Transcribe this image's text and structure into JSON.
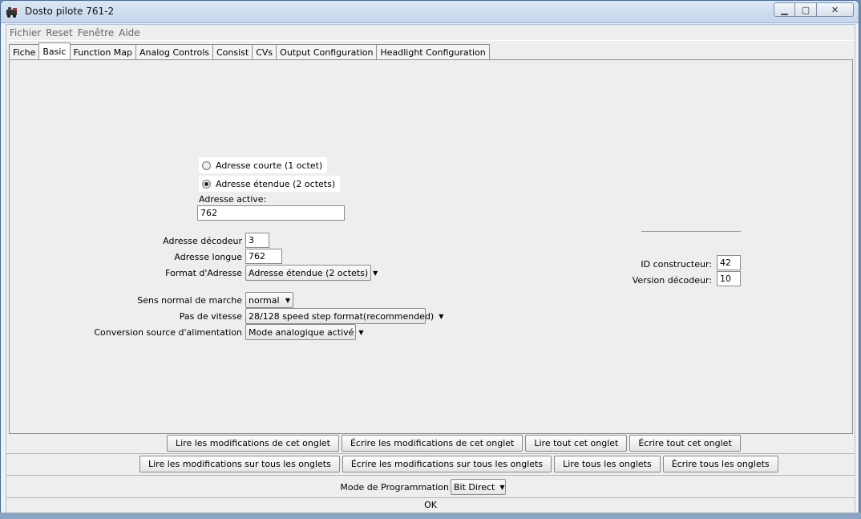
{
  "window": {
    "title": "Dosto pilote 761-2",
    "icon": "locomotive-icon"
  },
  "menu": [
    "Fichier",
    "Reset",
    "Fenêtre",
    "Aide"
  ],
  "tabs": [
    "Fiche",
    "Basic",
    "Function Map",
    "Analog Controls",
    "Consist",
    "CVs",
    "Output Configuration",
    "Headlight Configuration"
  ],
  "selected_tab": "Basic",
  "basic": {
    "radio_short": "Adresse courte (1 octet)",
    "radio_long": "Adresse étendue (2 octets)",
    "selected_radio": "Adresse étendue (2 octets)",
    "active_address_label": "Adresse active:",
    "active_address_value": "762",
    "decoder_address_label": "Adresse décodeur",
    "decoder_address_value": "3",
    "long_address_label": "Adresse longue",
    "long_address_value": "762",
    "address_format_label": "Format d'Adresse",
    "address_format_value": "Adresse étendue (2 octets)",
    "direction_label": "Sens normal de marche",
    "direction_value": "normal",
    "speed_steps_label": "Pas de vitesse",
    "speed_steps_value": "28/128 speed step format(recommended)",
    "power_conversion_label": "Conversion source d'alimentation",
    "power_conversion_value": "Mode analogique activé",
    "manufacturer_id_label": "ID constructeur:",
    "manufacturer_id_value": "42",
    "decoder_version_label": "Version décodeur:",
    "decoder_version_value": "10"
  },
  "buttons_tab": [
    "Lire les modifications de cet onglet",
    "Écrire les modifications de cet onglet",
    "Lire tout cet onglet",
    "Écrire tout cet onglet"
  ],
  "buttons_all": [
    "Lire les modifications sur tous les onglets",
    "Écrire les modifications sur tous les onglets",
    "Lire tous les onglets",
    "Écrire tous les onglets"
  ],
  "programming_mode_label": "Mode de Programmation",
  "programming_mode_value": "Bit Direct",
  "status": "OK"
}
